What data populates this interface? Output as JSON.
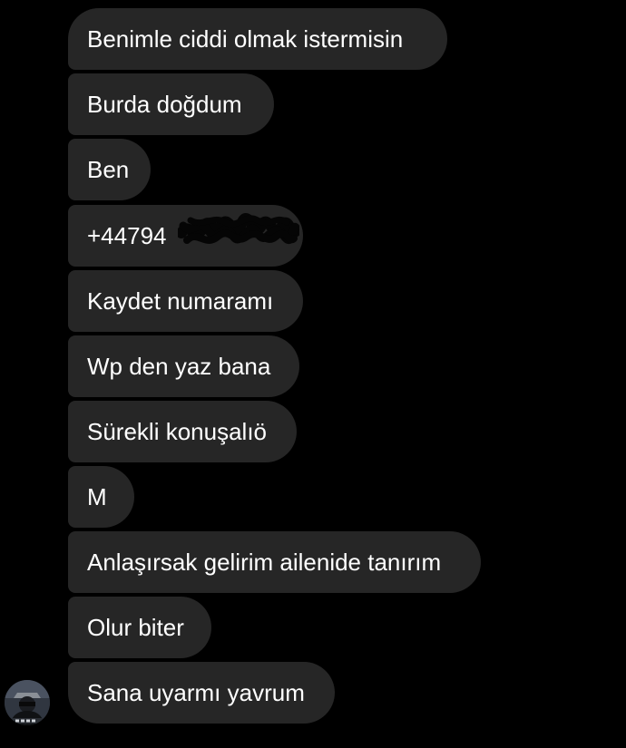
{
  "messages": [
    "Benimle ciddi olmak istermisin",
    "Burda doğdum",
    "Ben",
    "+44794",
    "Kaydet numaramı",
    "Wp den yaz bana",
    "Sürekli konuşalıö",
    "M",
    "Anlaşırsak gelirim ailenide tanırım",
    "Olur biter",
    "Sana uyarmı yavrum"
  ],
  "colors": {
    "background": "#000000",
    "bubble": "#262626",
    "text": "#ffffff"
  },
  "icons": {
    "avatar": "sender-avatar-icon",
    "redaction": "scribble-redaction"
  }
}
